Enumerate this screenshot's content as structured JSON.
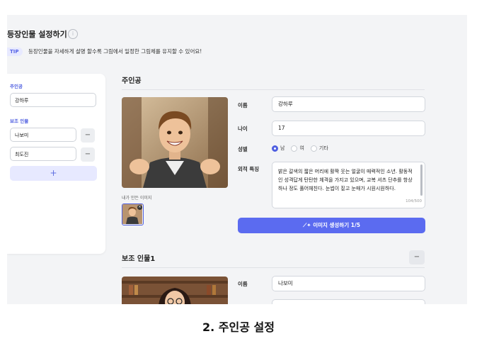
{
  "header": {
    "title": "등장인물 설정하기",
    "info_icon": "info-circle-icon"
  },
  "tip": {
    "badge": "TIP",
    "text": "등장인물을 자세하게 설명 할수록 그림에서 일정한 그림체를 유지할 수 있어요!"
  },
  "sidebar": {
    "main_label": "주인공",
    "main_value": "강하루",
    "support_label": "보조 인물",
    "supports": [
      "나보미",
      "최도진"
    ],
    "remove_label": "−",
    "add_label": "+"
  },
  "main_character": {
    "title": "주인공",
    "image_caption": "내가 만든 이미지",
    "fields": {
      "name_label": "이름",
      "name_value": "강하루",
      "age_label": "나이",
      "age_value": "17",
      "gender_label": "성별",
      "gender_options": [
        "남",
        "여",
        "기타"
      ],
      "gender_selected": "남",
      "appearance_label": "외적 특징",
      "appearance_value": "밝은 갈색의 짧은 머리에 활짝 웃는 얼굴이 매력적인 소년. 활동적인 성격답게 탄탄한 체격을 가지고 있으며, 교복 셔츠 단추를 항상 하나 정도 풀어헤친다. 눈썹이 짙고 눈매가 시원시원하다.",
      "appearance_count": "104/500"
    },
    "generate_button": "이미지 생성하기 1/5",
    "generate_icon": "magic-wand-icon"
  },
  "sub_character": {
    "title": "보조 인물1",
    "remove_label": "−",
    "name_label": "이름",
    "name_value": "나보미"
  },
  "caption": "2. 주인공 설정",
  "colors": {
    "accent": "#5b6bf0",
    "accent_light": "#e7e9ff",
    "panel_bg": "#f3f4f6"
  }
}
